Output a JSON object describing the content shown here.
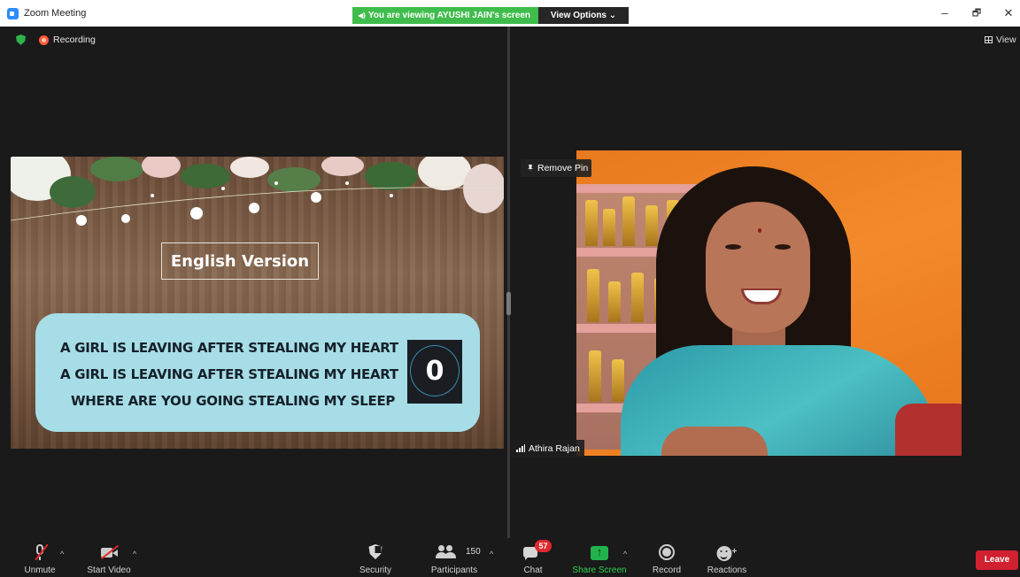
{
  "window": {
    "title": "Zoom Meeting",
    "viewing_banner": "You are viewing AYUSHI JAIN's screen",
    "view_options": "View Options ⌄",
    "minimize": "–",
    "restore": "🗗",
    "close": "✕"
  },
  "status": {
    "recording_label": "Recording",
    "view_label": "View"
  },
  "shared_screen": {
    "heading": "English Version",
    "lyrics": [
      "A GIRL IS LEAVING AFTER STEALING MY HEART",
      "A GIRL IS LEAVING AFTER STEALING MY HEART",
      "WHERE ARE YOU GOING STEALING MY SLEEP"
    ],
    "counter": "0"
  },
  "participant": {
    "remove_pin_label": "Remove Pin",
    "name": "Athira Rajan"
  },
  "toolbar": {
    "unmute": "Unmute",
    "start_video": "Start Video",
    "security": "Security",
    "participants": "Participants",
    "participants_count": "150",
    "chat": "Chat",
    "chat_badge": "57",
    "share_screen": "Share Screen",
    "record": "Record",
    "reactions": "Reactions",
    "leave": "Leave",
    "caret": "^"
  },
  "colors": {
    "banner_green": "#3fbc4b",
    "share_label_green": "#2fd14f",
    "leave_red": "#d12030",
    "badge_red": "#e0282e"
  }
}
